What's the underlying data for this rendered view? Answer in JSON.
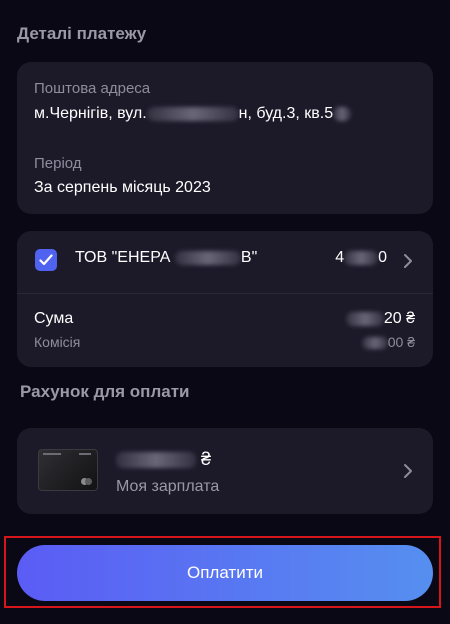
{
  "details": {
    "title": "Деталі платежу",
    "address_label": "Поштова адреса",
    "address_prefix": "м.Чернігів, вул.",
    "address_mid": "н, буд.",
    "address_build": "3",
    "address_kv": ", кв.",
    "address_tail": "5",
    "period_label": "Період",
    "period_value": "За серпень місяць 2023"
  },
  "payment": {
    "company_start": "ТОВ \"ЕНЕРА",
    "company_end": "В\"",
    "amount_start": "4",
    "amount_end": "0",
    "sum_label": "Сума",
    "sum_value_end": "20 ₴",
    "fee_label": "Комісія",
    "fee_value_end": "00 ₴"
  },
  "account": {
    "title": "Рахунок для оплати",
    "balance_currency": "₴",
    "name": "Моя зарплата"
  },
  "pay_button": {
    "label": "Оплатити"
  },
  "colors": {
    "background": "#0a0814",
    "card": "#1c1a29",
    "accent": "#4f63f0",
    "button_gradient_start": "#5b5cf4",
    "button_gradient_end": "#568ff0",
    "highlight": "#d7161b"
  }
}
